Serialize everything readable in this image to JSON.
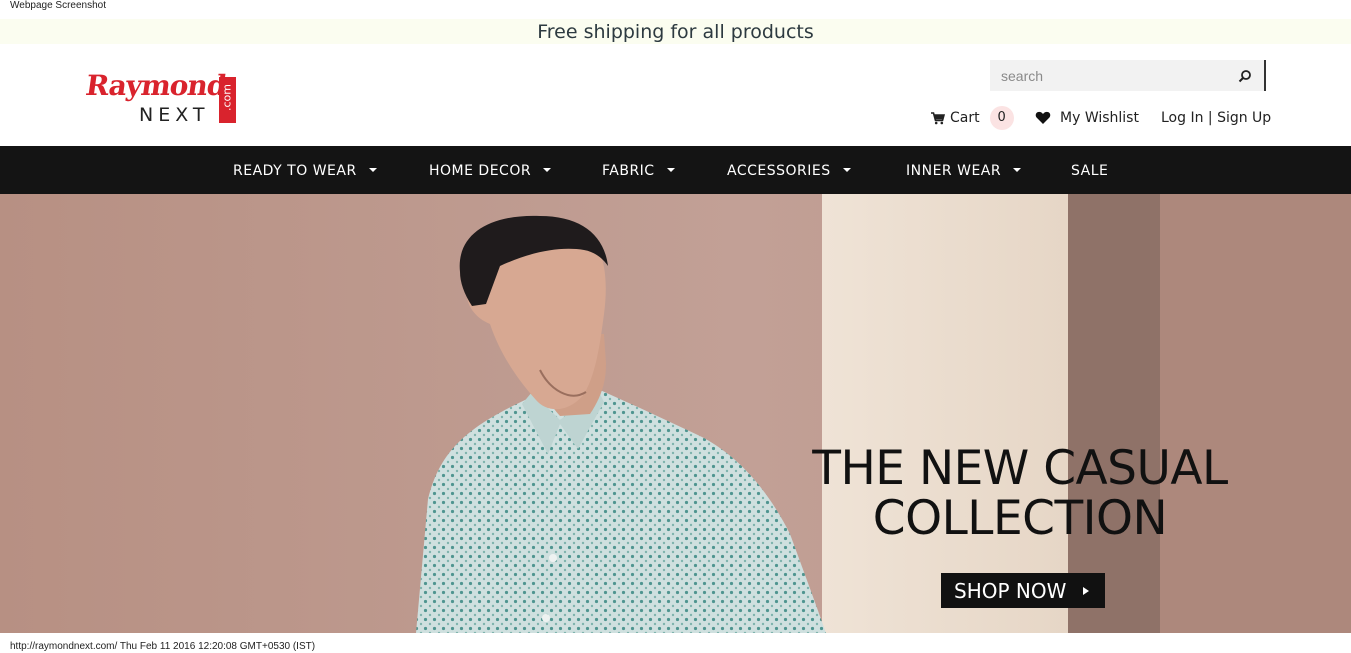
{
  "capture": {
    "top_label": "Webpage Screenshot",
    "bottom_label": "http://raymondnext.com/ Thu Feb 11 2016 12:20:08 GMT+0530 (IST)"
  },
  "promo": {
    "text": "Free shipping for all products"
  },
  "logo": {
    "top": "Raymond",
    "bottom": "NEXT",
    "suffix": ".com",
    "accent": "#d9232d"
  },
  "search": {
    "placeholder": "search",
    "value": "",
    "icon": "search-icon"
  },
  "header": {
    "cart_label": "Cart",
    "cart_count": "0",
    "wishlist_label": "My Wishlist",
    "login_label": "Log In | Sign Up"
  },
  "nav": {
    "items": [
      {
        "label": "READY TO WEAR",
        "dropdown": true
      },
      {
        "label": "HOME DECOR",
        "dropdown": true
      },
      {
        "label": "FABRIC",
        "dropdown": true
      },
      {
        "label": "ACCESSORIES",
        "dropdown": true
      },
      {
        "label": "INNER WEAR",
        "dropdown": true
      },
      {
        "label": "SALE",
        "dropdown": false
      }
    ]
  },
  "hero": {
    "title_line1": "THE NEW CASUAL",
    "title_line2": "COLLECTION",
    "cta": "SHOP NOW"
  },
  "colors": {
    "nav_bg": "#141414",
    "promo_bg": "#fbfdf0",
    "cart_badge": "#fbe3e3"
  }
}
